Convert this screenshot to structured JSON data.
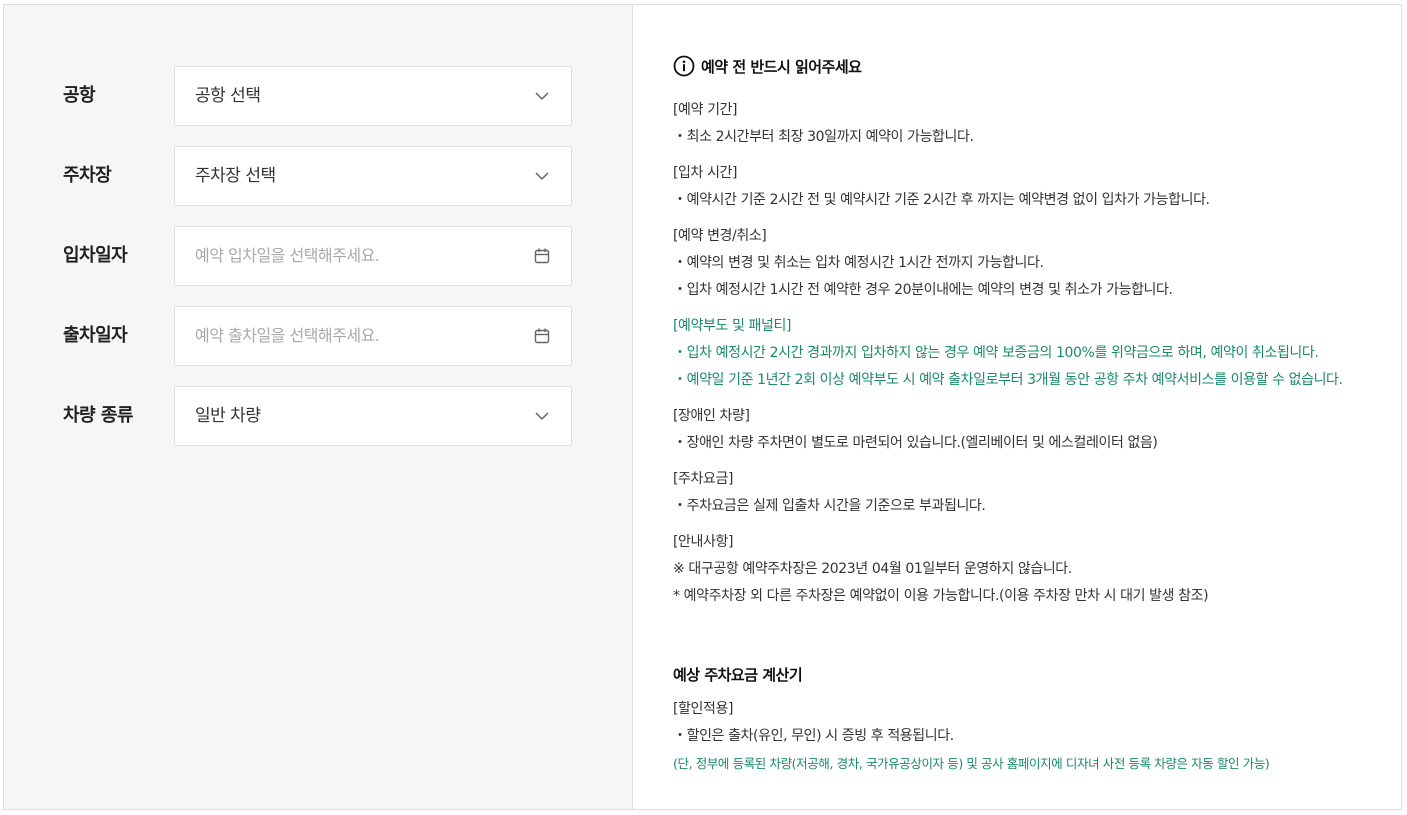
{
  "form": {
    "airport": {
      "label": "공항",
      "value": "공항 선택"
    },
    "parking": {
      "label": "주차장",
      "value": "주차장 선택"
    },
    "entry_date": {
      "label": "입차일자",
      "placeholder": "예약 입차일을 선택해주세요."
    },
    "exit_date": {
      "label": "출차일자",
      "placeholder": "예약 출차일을 선택해주세요."
    },
    "vehicle": {
      "label": "차량 종류",
      "value": "일반 차량"
    }
  },
  "notice": {
    "title": "예약 전 반드시 읽어주세요",
    "sections": [
      {
        "heading": "[예약 기간]",
        "lines": [
          "・최소 2시간부터 최장 30일까지 예약이 가능합니다."
        ]
      },
      {
        "heading": "[입차 시간]",
        "lines": [
          "・예약시간 기준 2시간 전 및 예약시간 기준 2시간 후 까지는 예약변경 없이 입차가 가능합니다."
        ]
      },
      {
        "heading": "[예약 변경/취소]",
        "lines": [
          "・예약의 변경 및 취소는 입차 예정시간 1시간 전까지 가능합니다.",
          "・입차 예정시간 1시간 전 예약한 경우 20분이내에는 예약의 변경 및 취소가 가능합니다."
        ]
      },
      {
        "heading": "[예약부도 및 패널티]",
        "lines": [
          "・입차 예정시간 2시간 경과까지 입차하지 않는 경우 예약 보증금의 100%를 위약금으로 하며, 예약이 취소됩니다.",
          "・예약일 기준 1년간 2회 이상 예약부도 시 예약 출차일로부터 3개월 동안 공항 주차 예약서비스를 이용할 수 없습니다."
        ]
      },
      {
        "heading": "[장애인 차량]",
        "lines": [
          "・장애인 차량 주차면이 별도로 마련되어 있습니다.(엘리베이터 및 에스컬레이터 없음)"
        ]
      },
      {
        "heading": "[주차요금]",
        "lines": [
          "・주차요금은 실제 입출차 시간을 기준으로 부과됩니다."
        ]
      },
      {
        "heading": "[안내사항]",
        "lines": [
          "※ 대구공항 예약주차장은 2023년 04월 01일부터 운영하지 않습니다.",
          "* 예약주차장 외 다른 주차장은 예약없이 이용 가능합니다.(이용 주차장 만차 시 대기 발생 참조)"
        ]
      }
    ]
  },
  "calculator": {
    "title": "예상 주차요금 계산기",
    "heading": "[할인적용]",
    "line": "・할인은 출차(유인, 무인) 시 증빙 후 적용됩니다.",
    "note": "(단, 정부에 등록된 차량(저공해, 경차, 국가유공상이자 등) 및 공사 홈페이지에 디자녀 사전 등록 차량은 자동 할인 가능)"
  },
  "colors": {
    "accent_green": "#1a8a6a",
    "border": "#dcdcdc",
    "panel_bg": "#f6f6f6"
  },
  "icons": {
    "select": "chevron-down-icon",
    "date": "calendar-icon",
    "info": "info-circle-icon"
  }
}
